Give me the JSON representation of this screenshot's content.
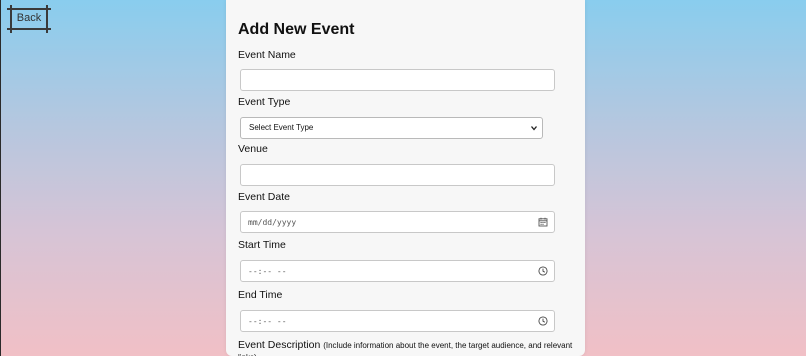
{
  "back_button": {
    "label": "Back"
  },
  "form": {
    "title": "Add New Event",
    "event_name": {
      "label": "Event Name",
      "value": ""
    },
    "event_type": {
      "label": "Event Type",
      "selected": "Select Event Type"
    },
    "venue": {
      "label": "Venue",
      "value": ""
    },
    "event_date": {
      "label": "Event Date",
      "placeholder": "mm/dd/yyyy"
    },
    "start_time": {
      "label": "Start Time",
      "placeholder": "--:-- --"
    },
    "end_time": {
      "label": "End Time",
      "placeholder": "--:-- --"
    },
    "event_description": {
      "label": "Event Description",
      "hint": "(Include information about the event, the target audience, and relevant links)"
    }
  },
  "icons": {
    "date": "calendar-icon",
    "start_time": "clock-icon",
    "end_time": "clock-icon",
    "select": "chevron-down-icon"
  },
  "colors": {
    "background_top": "#89cdee",
    "background_bottom": "#f1c0c6",
    "card": "#f7f7f7"
  }
}
